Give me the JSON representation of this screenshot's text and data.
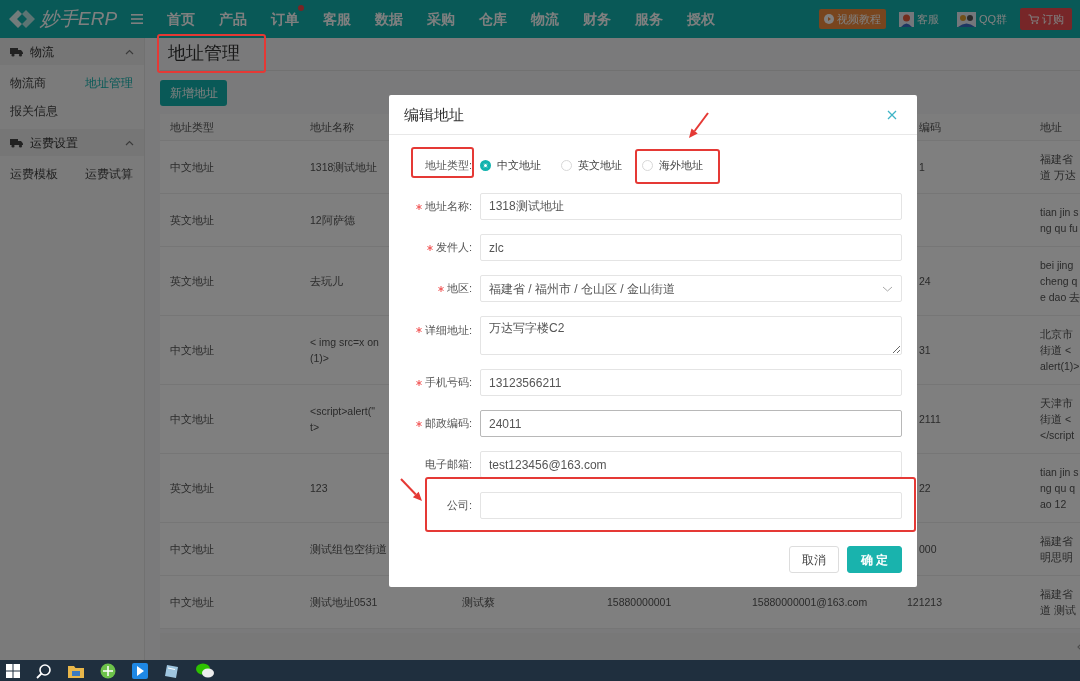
{
  "navbar": {
    "logo": "妙手ERP",
    "items": [
      {
        "label": "首页",
        "dot": false
      },
      {
        "label": "产品",
        "dot": false
      },
      {
        "label": "订单",
        "dot": true
      },
      {
        "label": "客服",
        "dot": false
      },
      {
        "label": "数据",
        "dot": false
      },
      {
        "label": "采购",
        "dot": false
      },
      {
        "label": "仓库",
        "dot": false
      },
      {
        "label": "物流",
        "dot": false
      },
      {
        "label": "财务",
        "dot": false
      },
      {
        "label": "服务",
        "dot": false
      },
      {
        "label": "授权",
        "dot": false
      }
    ],
    "actions": [
      {
        "kind": "video",
        "label": "视频教程"
      },
      {
        "kind": "service",
        "label": "客服"
      },
      {
        "kind": "qq",
        "label": "QQ群"
      },
      {
        "kind": "order",
        "label": "订购"
      }
    ]
  },
  "sidebar": {
    "sections": [
      {
        "title": "物流",
        "expanded": true,
        "items": [
          {
            "label": "物流商",
            "selected": false
          },
          {
            "label": "地址管理",
            "selected": true
          },
          {
            "label": "报关信息",
            "selected": false
          }
        ]
      },
      {
        "title": "运费设置",
        "expanded": true,
        "items": [
          {
            "label": "运费模板",
            "selected": false
          },
          {
            "label": "运费试算",
            "selected": false
          }
        ]
      }
    ]
  },
  "page": {
    "title": "地址管理",
    "add_button": "新增地址"
  },
  "table": {
    "header": {
      "type": "地址类型",
      "name": "地址名称",
      "postcode": "编码",
      "address": "地址"
    },
    "rows": [
      {
        "type": "中文地址",
        "name": [
          "1318测试地址"
        ],
        "postcode": "1",
        "address": [
          "福建省",
          "道 万达"
        ]
      },
      {
        "type": "英文地址",
        "name": [
          "12阿萨德"
        ],
        "address": [
          "tian jin s",
          "ng qu fu"
        ]
      },
      {
        "type": "英文地址",
        "name": [
          "去玩儿"
        ],
        "postcode": "24",
        "address": [
          "bei jing",
          "cheng q",
          "e dao 去"
        ]
      },
      {
        "type": "中文地址",
        "name": [
          "< img src=x on",
          "(1)>"
        ],
        "postcode": "31",
        "address": [
          "北京市",
          "街道 <",
          "alert(1)>"
        ]
      },
      {
        "type": "中文地址",
        "name": [
          "<script>alert(\"",
          "t>"
        ],
        "postcode": "2111",
        "address": [
          "天津市",
          "街道 <",
          "</script"
        ]
      },
      {
        "type": "英文地址",
        "name": [
          "123"
        ],
        "postcode": "22",
        "address": [
          "tian jin s",
          "ng qu q",
          "ao 12"
        ]
      },
      {
        "type": "中文地址",
        "name": [
          "测试组包空街道"
        ],
        "postcode": "000",
        "address": [
          "福建省",
          "明思明"
        ]
      },
      {
        "type": "中文地址",
        "name": [
          "测试地址0531"
        ],
        "sender": "测试蔡",
        "phone": "15880000001",
        "email": "15880000001@163.com",
        "postcode": "121213",
        "address": [
          "福建省",
          "道 测试"
        ]
      }
    ]
  },
  "dialog": {
    "title": "编辑地址",
    "fields": [
      {
        "kind": "radio",
        "label": "地址类型:",
        "required": false,
        "options": [
          {
            "label": "中文地址",
            "selected": true
          },
          {
            "label": "英文地址",
            "selected": false
          },
          {
            "label": "海外地址",
            "selected": false
          }
        ]
      },
      {
        "kind": "input",
        "label": "地址名称:",
        "required": true,
        "value": "1318测试地址",
        "focused": false
      },
      {
        "kind": "input",
        "label": "发件人:",
        "required": true,
        "value": "zlc",
        "focused": false
      },
      {
        "kind": "select",
        "label": "地区:",
        "required": true,
        "value": "福建省 / 福州市 / 仓山区 / 金山街道",
        "focused": false
      },
      {
        "kind": "textarea",
        "label": "详细地址:",
        "required": true,
        "value": "万达写字楼C2",
        "focused": false
      },
      {
        "kind": "input",
        "label": "手机号码:",
        "required": true,
        "value": "13123566211",
        "focused": false
      },
      {
        "kind": "input",
        "label": "邮政编码:",
        "required": true,
        "value": "24011",
        "focused": true
      },
      {
        "kind": "input",
        "label": "电子邮箱:",
        "required": false,
        "value": "test123456@163.com",
        "focused": false
      },
      {
        "kind": "input",
        "label": "公司:",
        "required": false,
        "focused": false
      }
    ],
    "buttons": [
      {
        "kind": "cancel",
        "label": "取消"
      },
      {
        "kind": "primary",
        "label": "确 定"
      }
    ]
  }
}
